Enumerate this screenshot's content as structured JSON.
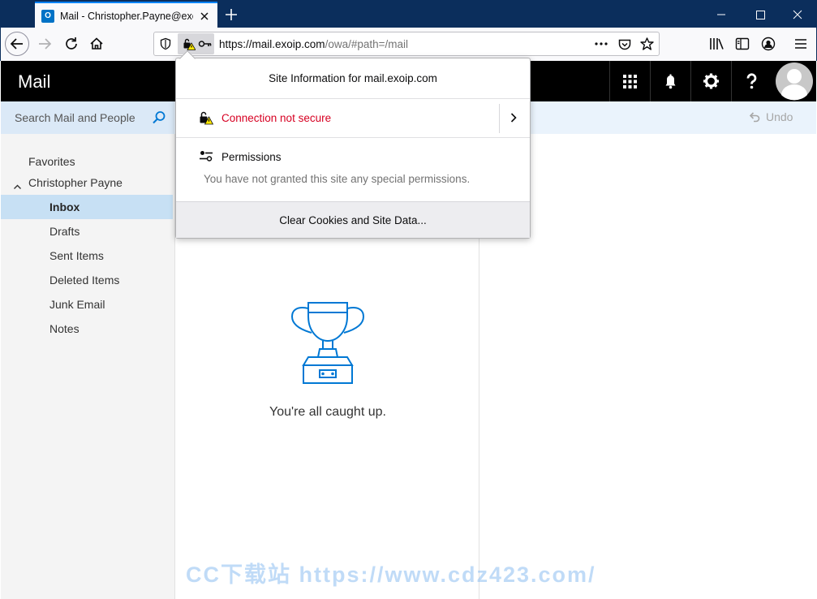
{
  "browser": {
    "tab_title": "Mail - Christopher.Payne@exoip.com",
    "tab_favicon": "O",
    "url_host": "https://mail.exoip.com",
    "url_path": "/owa/#path=/mail"
  },
  "app": {
    "title": "Mail",
    "search_placeholder": "Search Mail and People",
    "undo_label": "Undo"
  },
  "folders": {
    "favorites": "Favorites",
    "account": "Christopher Payne",
    "items": [
      {
        "label": "Inbox",
        "selected": true
      },
      {
        "label": "Drafts"
      },
      {
        "label": "Sent Items"
      },
      {
        "label": "Deleted Items"
      },
      {
        "label": "Junk Email"
      },
      {
        "label": "Notes"
      }
    ]
  },
  "message_list": {
    "empty_text": "You're all caught up."
  },
  "site_info": {
    "title": "Site Information for mail.exoip.com",
    "connection": "Connection not secure",
    "permissions_title": "Permissions",
    "permissions_desc": "You have not granted this site any special permissions.",
    "clear_button": "Clear Cookies and Site Data..."
  },
  "watermark": "CC下载站 https://www.cdz423.com/",
  "colors": {
    "titlebar": "#0b2e5c",
    "owa_header": "#000000",
    "selected_folder": "#c7e0f4",
    "insecure_red": "#d70022",
    "accent_blue": "#0078d4"
  }
}
